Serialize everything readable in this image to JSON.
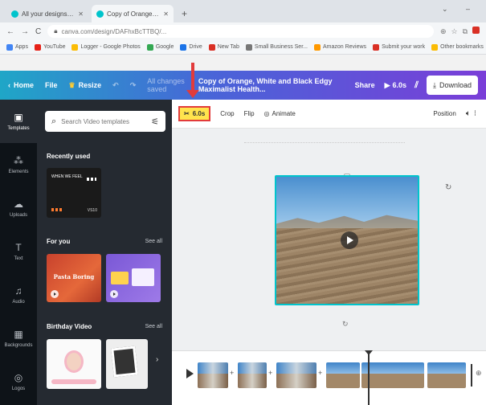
{
  "browser": {
    "tabs": [
      {
        "title": "All your designs - Canva"
      },
      {
        "title": "Copy of Orange, White and Bla"
      }
    ],
    "new_tab": "+",
    "address": "canva.com/design/DAFhxBcTTBQ/...",
    "bookmarks": [
      {
        "label": "Apps",
        "color": "#4285f4"
      },
      {
        "label": "YouTube",
        "color": "#e62117"
      },
      {
        "label": "Logger - Google Photos",
        "color": "#fbbc05"
      },
      {
        "label": "Google",
        "color": "#34a853"
      },
      {
        "label": "Drive",
        "color": "#1a73e8"
      },
      {
        "label": "New Tab",
        "color": "#d93025"
      },
      {
        "label": "Small Business Ser...",
        "color": "#777777"
      },
      {
        "label": "Amazon Reviews",
        "color": "#ff9900"
      },
      {
        "label": "Submit your work",
        "color": "#d93025"
      },
      {
        "label": "Other bookmarks",
        "color": "#fbbc05"
      }
    ]
  },
  "topbar": {
    "home": "Home",
    "file": "File",
    "resize": "Resize",
    "saved_status": "All changes saved",
    "doc_title": "Copy of Orange, White and Black Edgy Maximalist Health...",
    "share": "Share",
    "duration": "6.0s",
    "download": "Download"
  },
  "rail": {
    "items": [
      {
        "label": "Templates",
        "icon": "templates-icon"
      },
      {
        "label": "Elements",
        "icon": "elements-icon"
      },
      {
        "label": "Uploads",
        "icon": "uploads-icon"
      },
      {
        "label": "Text",
        "icon": "text-icon"
      },
      {
        "label": "Audio",
        "icon": "audio-icon"
      },
      {
        "label": "Backgrounds",
        "icon": "backgrounds-icon"
      },
      {
        "label": "Logos",
        "icon": "logos-icon"
      }
    ]
  },
  "panel": {
    "search_placeholder": "Search Video templates",
    "recently_used": "Recently used",
    "for_you": "For you",
    "see_all": "See all",
    "birthday_video": "Birthday Video",
    "recent_thumb_title": "WHEN WE FEEL",
    "recent_thumb_sub": "VS10",
    "foryou_thumb_label": "Pasta Boring"
  },
  "editor_toolbar": {
    "trim": "6.0s",
    "crop": "Crop",
    "flip": "Flip",
    "animate": "Animate",
    "position": "Position"
  },
  "colors": {
    "accent": "#00c4cc",
    "highlight": "#ffe44d",
    "annotation": "#e23b3b"
  }
}
